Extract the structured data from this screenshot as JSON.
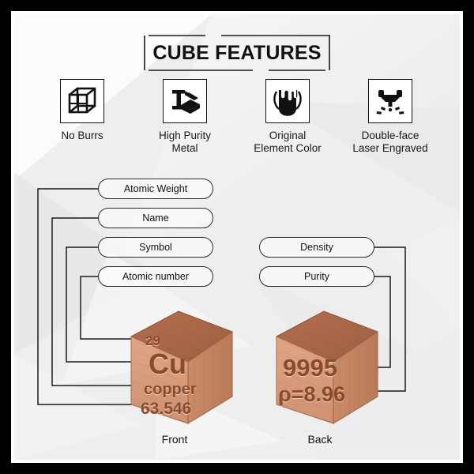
{
  "header": {
    "title": "CUBE FEATURES"
  },
  "features": [
    {
      "icon": "wireframe-cube-icon",
      "label": "No Burrs"
    },
    {
      "icon": "i-beam-steel-icon",
      "label": "High Purity\nMetal"
    },
    {
      "icon": "molten-metal-pour-icon",
      "label": "Original\nElement Color"
    },
    {
      "icon": "laser-engraving-icon",
      "label": "Double-face\nLaser Engraved"
    }
  ],
  "callouts": {
    "left": [
      {
        "label": "Atomic Weight",
        "target": "atomic-weight"
      },
      {
        "label": "Name",
        "target": "name"
      },
      {
        "label": "Symbol",
        "target": "symbol"
      },
      {
        "label": "Atomic number",
        "target": "atomic-number"
      }
    ],
    "right": [
      {
        "label": "Density",
        "target": "density"
      },
      {
        "label": "Purity",
        "target": "purity"
      }
    ]
  },
  "cubes": {
    "front": {
      "caption": "Front",
      "atomic_number": "29",
      "symbol": "Cu",
      "name": "copper",
      "atomic_weight": "63.546"
    },
    "back": {
      "caption": "Back",
      "purity": "9995",
      "density": "ρ=8.96"
    }
  },
  "colors": {
    "background": "#eeeeee",
    "frame": "#000000",
    "line": "#2b2b2b",
    "copper_top": "#a8664a",
    "copper_front": "#d89b7a",
    "copper_side": "#c07f5e",
    "engraving": "#8a4a2e"
  }
}
